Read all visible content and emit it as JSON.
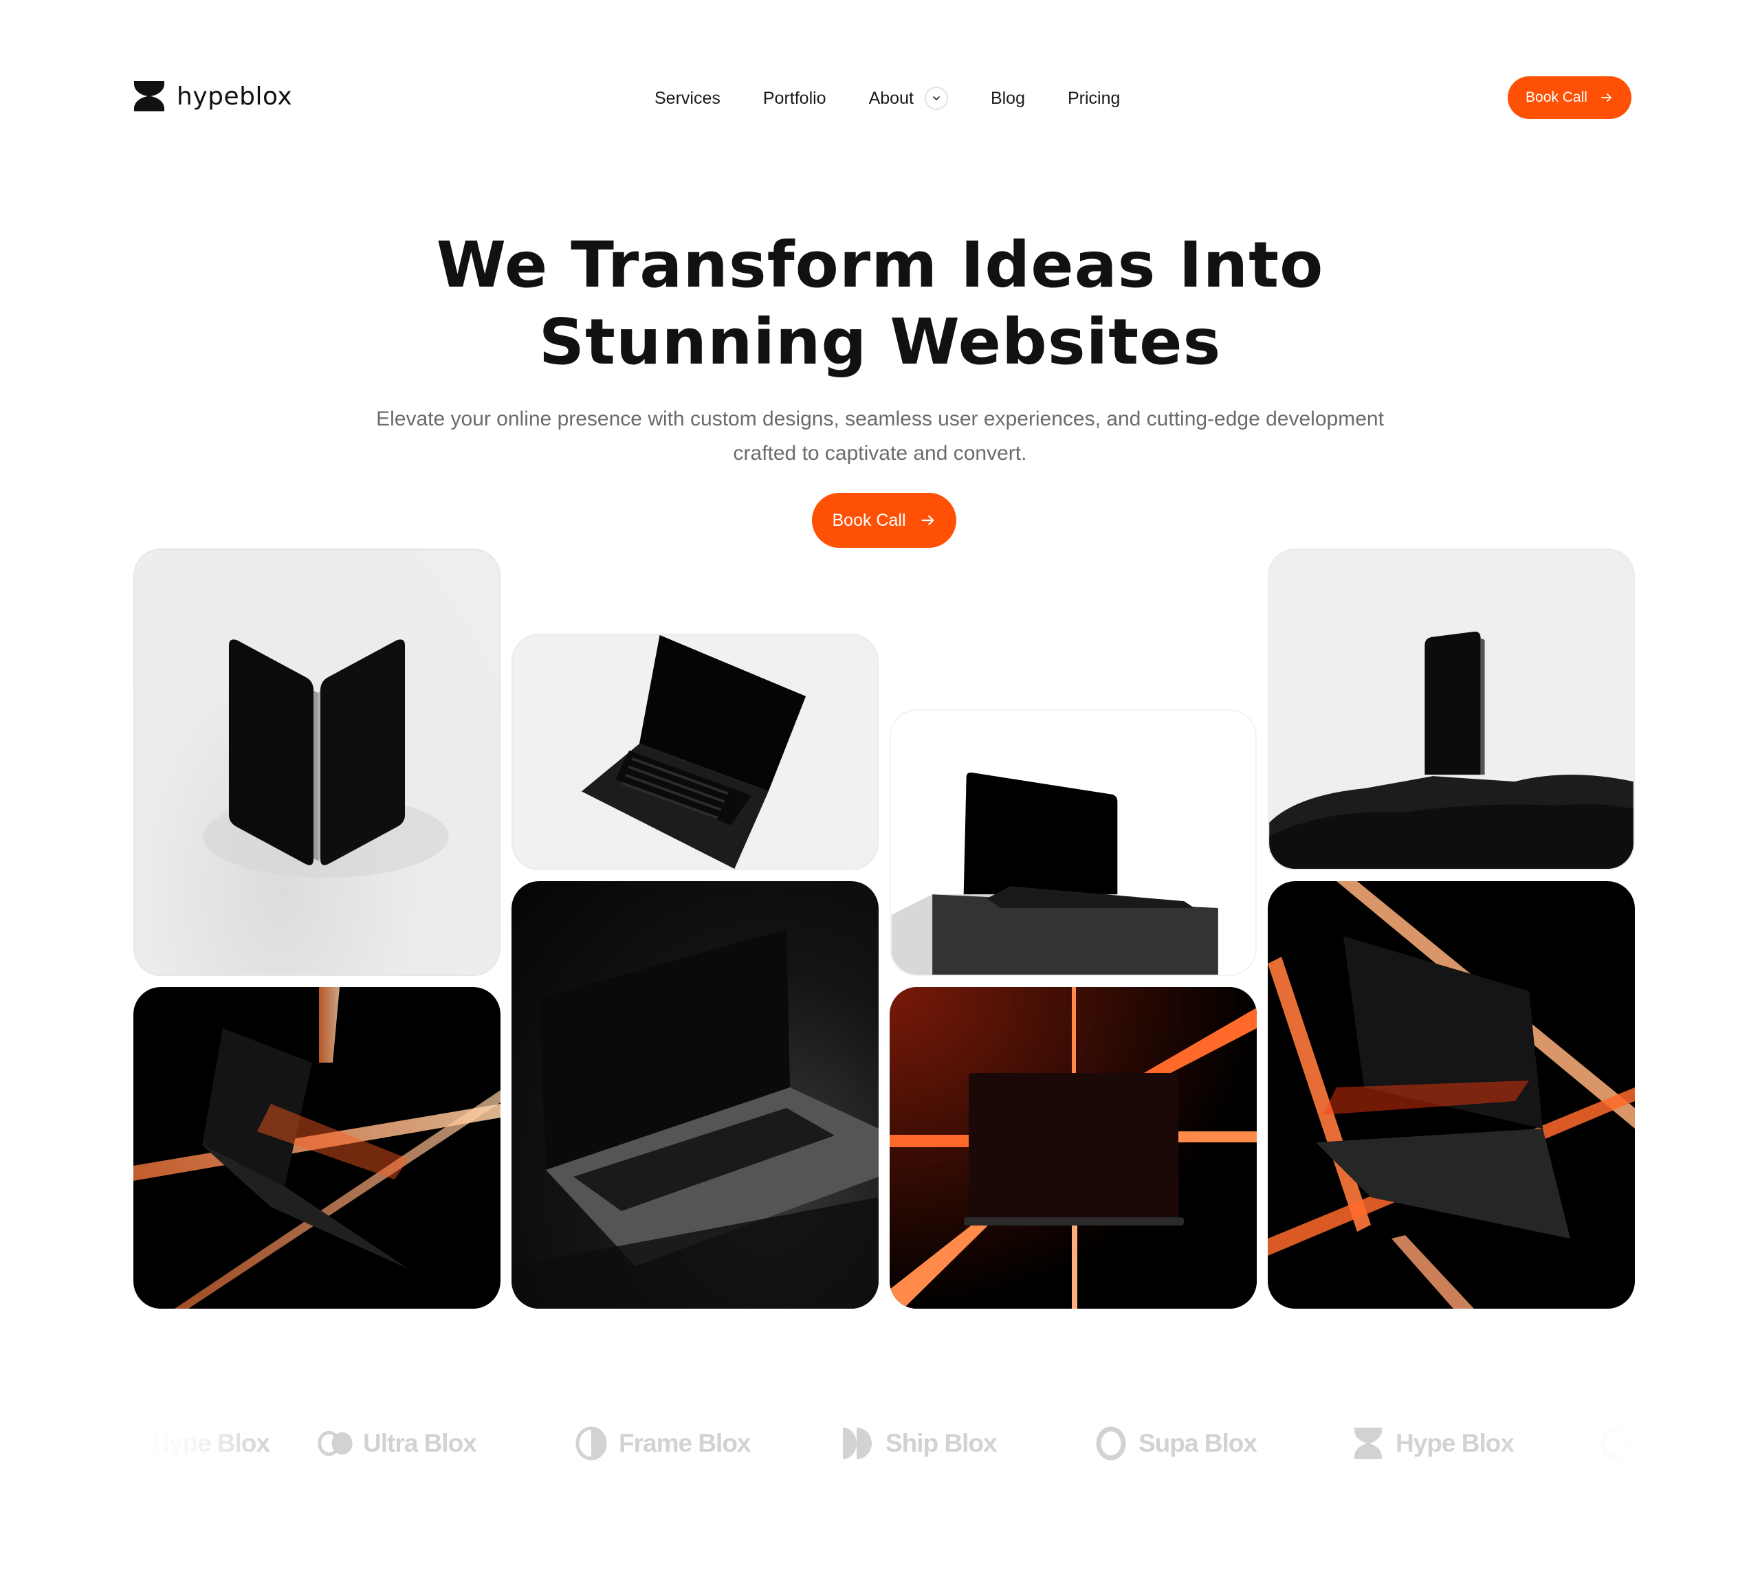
{
  "header": {
    "logo_text": "hypeblox",
    "logo_icon": "hourglass-logo-icon",
    "nav": [
      {
        "label": "Services"
      },
      {
        "label": "Portfolio"
      },
      {
        "label": "About",
        "has_dropdown": true,
        "dropdown_icon": "chevron-down-icon"
      },
      {
        "label": "Blog"
      },
      {
        "label": "Pricing"
      }
    ],
    "cta_label": "Book Call",
    "cta_icon": "arrow-right-icon"
  },
  "hero": {
    "title_line1": "We Transform Ideas Into",
    "title_line2": "Stunning Websites",
    "subtitle_line1": "Elevate your online presence with custom designs, seamless user experiences, and cutting-edge development",
    "subtitle_line2": "crafted to captivate and convert.",
    "cta_label": "Book Call",
    "cta_icon": "arrow-right-icon"
  },
  "gallery": [
    {
      "subject": "two phones standing back to back on light background"
    },
    {
      "subject": "open laptop tilted on light background"
    },
    {
      "subject": "laptop resting on concrete block"
    },
    {
      "subject": "phone standing on dark rock"
    },
    {
      "subject": "floating laptop with orange light beams"
    },
    {
      "subject": "open laptop in dark scene"
    },
    {
      "subject": "laptop front view with orange light beams"
    },
    {
      "subject": "laptop with orange light beams, angled view"
    }
  ],
  "brands": [
    {
      "name": "Hype Blox",
      "icon": "hourglass-icon"
    },
    {
      "name": "Ultra Blox",
      "icon": "overlapping-circles-icon"
    },
    {
      "name": "Frame Blox",
      "icon": "half-circle-icon"
    },
    {
      "name": "Ship Blox",
      "icon": "double-half-circle-icon"
    },
    {
      "name": "Supa Blox",
      "icon": "ring-icon"
    },
    {
      "name": "Hype Blox",
      "icon": "hourglass-icon"
    },
    {
      "name": "",
      "icon": "ring-icon"
    }
  ],
  "colors": {
    "accent": "#ff5106",
    "text": "#111111",
    "muted": "#6b6b6b",
    "brand_gray": "#d2d2d2"
  }
}
